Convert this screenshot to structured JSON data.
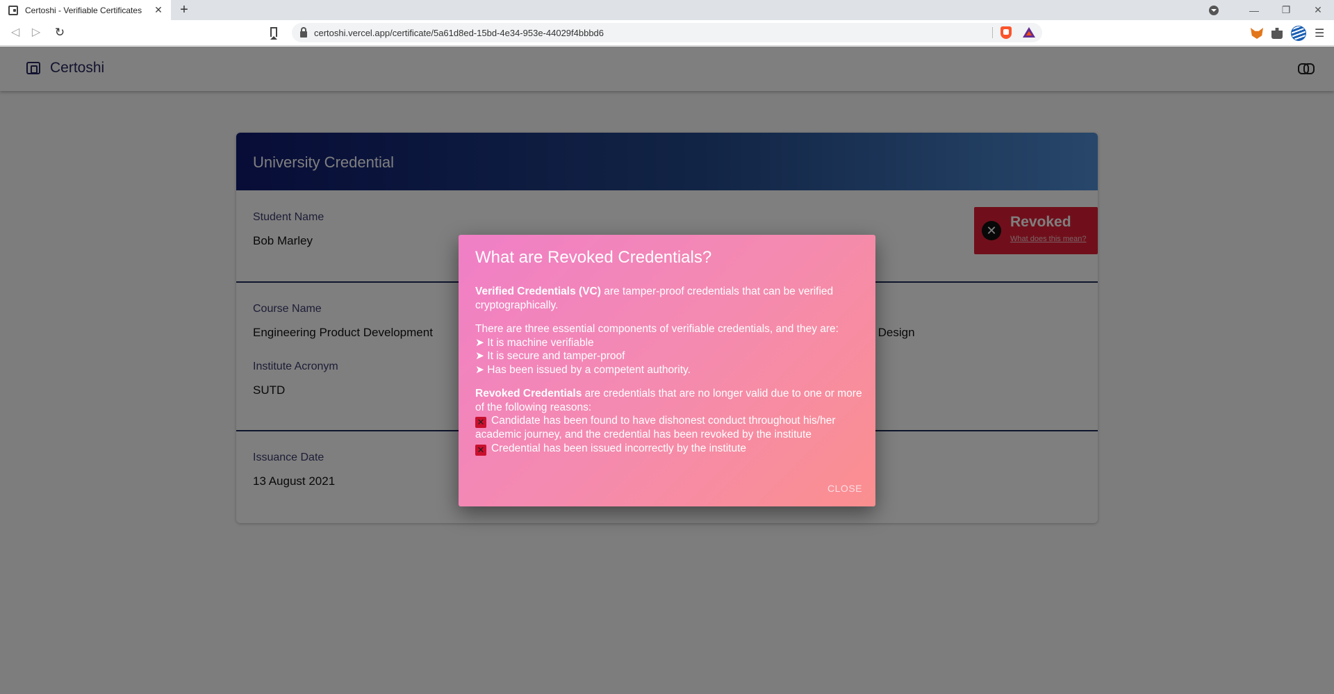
{
  "browser": {
    "tab_title": "Certoshi - Verifiable Certificates",
    "tab_close": "✕",
    "new_tab": "+",
    "url": "certoshi.vercel.app/certificate/5a61d8ed-15bd-4e34-953e-44029f4bbbd6",
    "nav_back": "◁",
    "nav_forward": "▷",
    "nav_reload": "↻",
    "win_minimize": "—",
    "win_restore": "❐",
    "win_close": "✕",
    "menu": "☰"
  },
  "app": {
    "brand": "Certoshi"
  },
  "credential": {
    "header": "University Credential",
    "fields": {
      "student_name_label": "Student Name",
      "student_name": "Bob Marley",
      "course_name_label": "Course Name",
      "course_name": "Engineering Product Development",
      "course_name_right_fragment": "nd Design",
      "institute_label": "Institute Acronym",
      "institute": "SUTD",
      "issuance_label": "Issuance Date",
      "issuance_date": "13 August 2021"
    },
    "status": {
      "label": "Revoked",
      "link": "What does this mean?",
      "color": "#e01e37"
    }
  },
  "modal": {
    "title": "What are Revoked Credentials?",
    "p1_bold": "Verified Credentials (VC)",
    "p1_text": " are tamper-proof credentials that can be verified cryptographically.",
    "p2_intro": "There are three essential components of verifiable credentials, and they are:",
    "bullets": [
      "➤ It is machine verifiable",
      "➤ It is secure and tamper-proof",
      "➤ Has been issued by a competent authority."
    ],
    "p3_bold": "Revoked Credentials",
    "p3_text": " are credentials that are no longer valid due to one or more of the following reasons:",
    "reasons": [
      "Candidate has been found to have dishonest conduct throughout his/her academic journey, and the credential has been revoked by the institute",
      "Credential has been issued incorrectly by the institute"
    ],
    "reason_icon": "✕",
    "close_label": "CLOSE"
  }
}
